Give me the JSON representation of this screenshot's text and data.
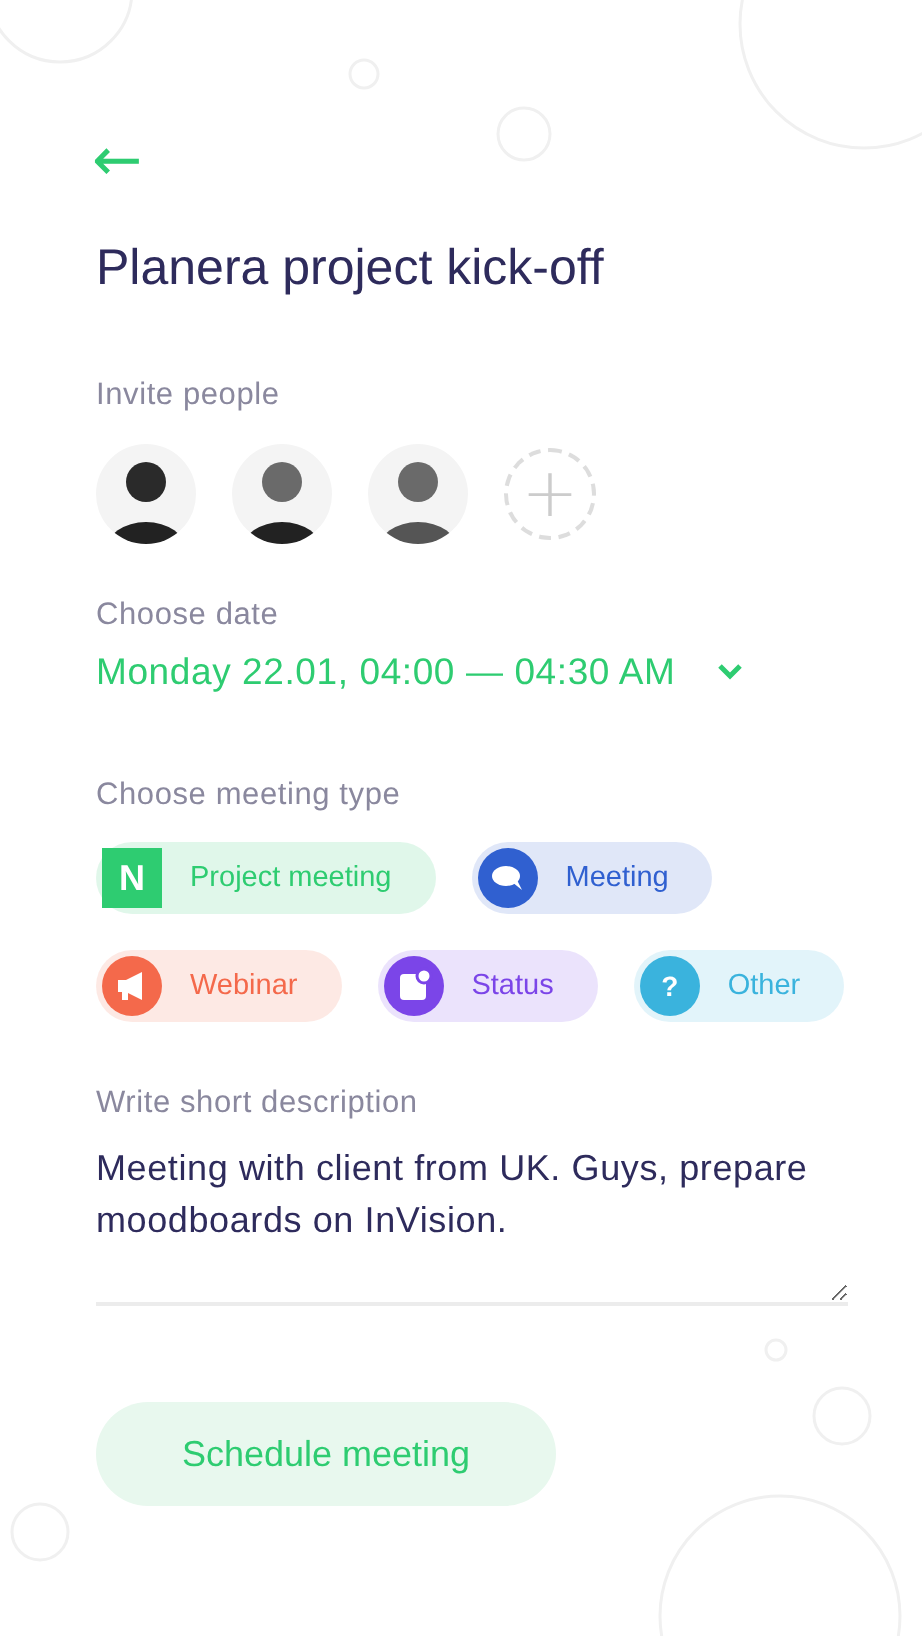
{
  "back_button": {
    "label": "←"
  },
  "title": "Planera project kick-off",
  "invite": {
    "label": "Invite people",
    "add_label": "+"
  },
  "date": {
    "label": "Choose date",
    "value": "Monday 22.01, 04:00 — 04:30 AM"
  },
  "meeting_type": {
    "label": "Choose meeting type",
    "types": [
      {
        "kind": "project",
        "label": "Project meeting",
        "icon_text": "N",
        "color": "#2ecc71"
      },
      {
        "kind": "meeting",
        "label": "Meeting",
        "color": "#3060d0"
      },
      {
        "kind": "webinar",
        "label": "Webinar",
        "color": "#f4694b"
      },
      {
        "kind": "status",
        "label": "Status",
        "color": "#7b45e8"
      },
      {
        "kind": "other",
        "label": "Other",
        "icon_text": "?",
        "color": "#3ab3dd"
      }
    ]
  },
  "description": {
    "label": "Write short description",
    "value": "Meeting with client from UK. Guys, prepare moodboards on InVision."
  },
  "submit": {
    "label": "Schedule meeting"
  }
}
